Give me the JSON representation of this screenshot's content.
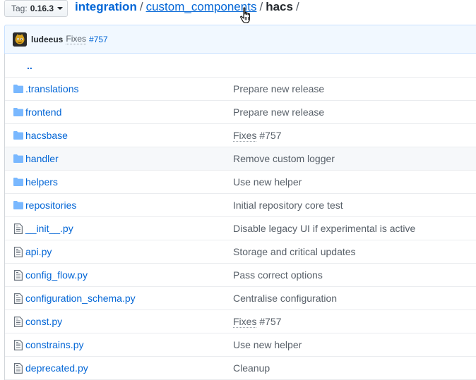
{
  "colors": {
    "link": "#0366d6",
    "text": "#24292e",
    "muted": "#586069",
    "commit_bar_bg": "#f1f8ff",
    "folder_icon": "#79b8ff",
    "file_icon": "#6a737d"
  },
  "tag_selector": {
    "prefix": "Tag:",
    "value": "0.16.3",
    "icon": "chevron-down-icon"
  },
  "breadcrumb": {
    "root": "integration",
    "sep1": "/",
    "link": "custom_components",
    "sep2": "/",
    "current": "hacs",
    "sep3": "/"
  },
  "latest_commit": {
    "author": "ludeeus",
    "message": "Fixes",
    "ref": "#757"
  },
  "parent_dir": {
    "label": ".."
  },
  "files": [
    {
      "type": "folder",
      "name": ".translations",
      "message": "Prepare new release"
    },
    {
      "type": "folder",
      "name": "frontend",
      "message": "Prepare new release"
    },
    {
      "type": "folder",
      "name": "hacsbase",
      "message_prefix": "Fixes",
      "message": " #757"
    },
    {
      "type": "folder",
      "name": "handler",
      "message": "Remove custom logger"
    },
    {
      "type": "folder",
      "name": "helpers",
      "message": "Use new helper"
    },
    {
      "type": "folder",
      "name": "repositories",
      "message": "Initial repository core test"
    },
    {
      "type": "file",
      "name": "__init__.py",
      "message": "Disable legacy UI if experimental is active"
    },
    {
      "type": "file",
      "name": "api.py",
      "message": "Storage and critical updates"
    },
    {
      "type": "file",
      "name": "config_flow.py",
      "message": "Pass correct options"
    },
    {
      "type": "file",
      "name": "configuration_schema.py",
      "message": "Centralise configuration"
    },
    {
      "type": "file",
      "name": "const.py",
      "message_prefix": "Fixes",
      "message": " #757"
    },
    {
      "type": "file",
      "name": "constrains.py",
      "message": "Use new helper"
    },
    {
      "type": "file",
      "name": "deprecated.py",
      "message": "Cleanup"
    }
  ]
}
